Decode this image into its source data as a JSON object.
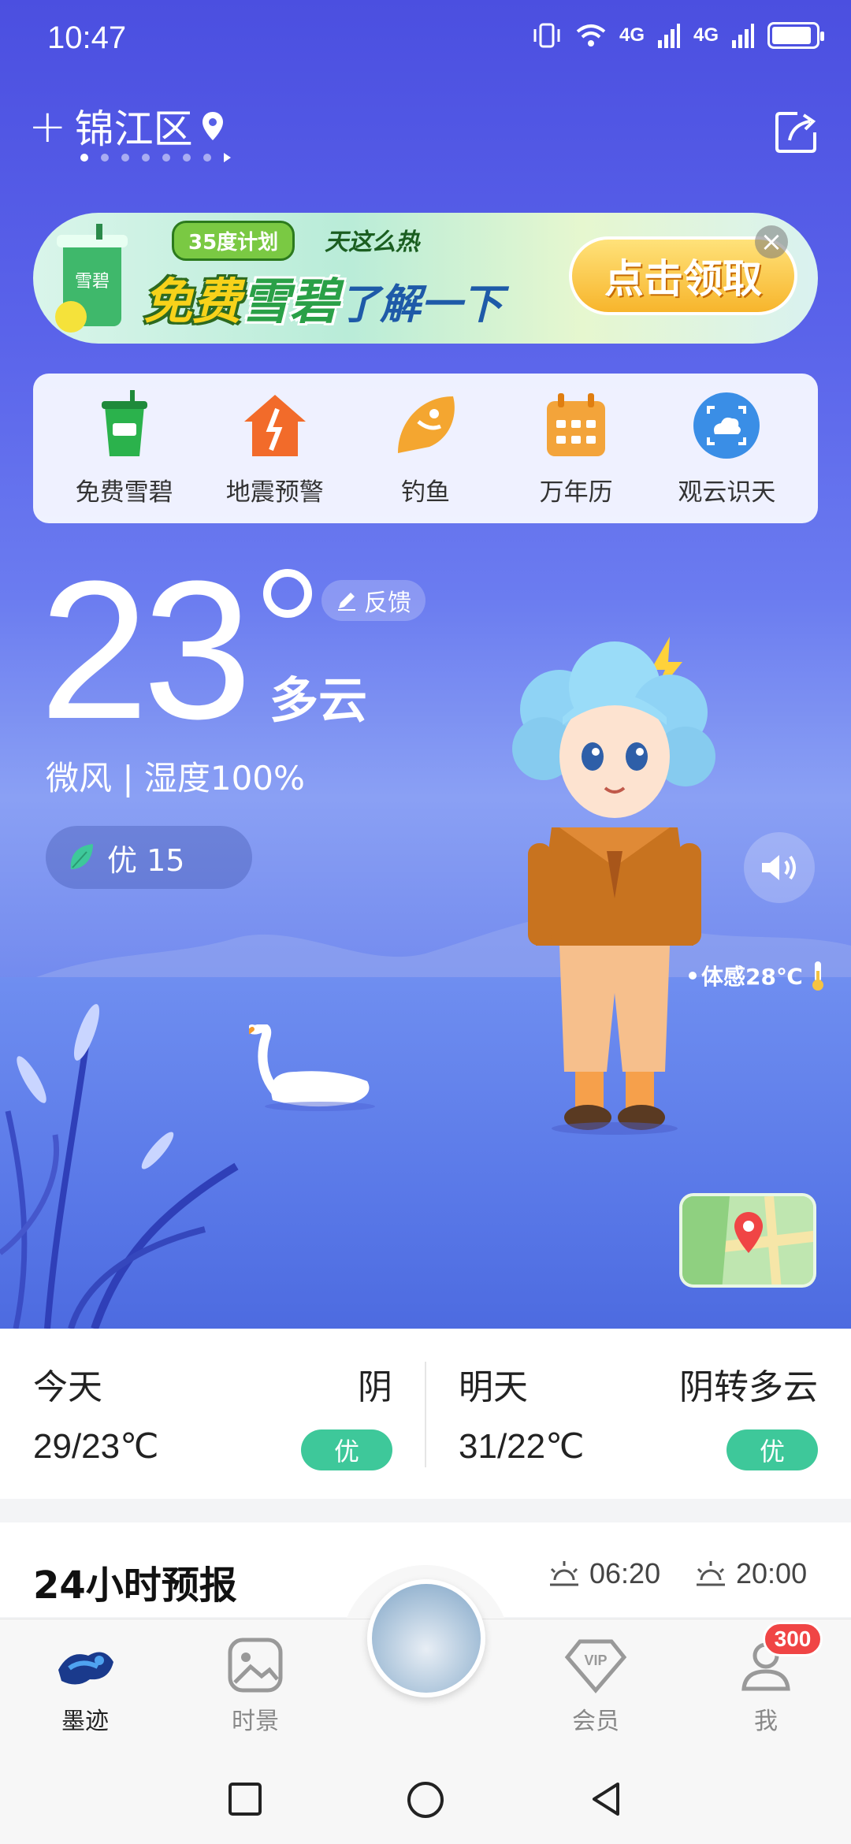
{
  "status": {
    "time": "10:47",
    "net1": "4G",
    "net2": "4G",
    "battery_level": 0.9
  },
  "location": {
    "add_symbol": "+",
    "city": "锦江区",
    "page_count": 7,
    "active_page": 1
  },
  "banner": {
    "tag": "35度计划",
    "subtitle": "天这么热",
    "main_1": "免费",
    "main_2": "雪碧",
    "main_3": "了解一下",
    "cup_text": "雪碧",
    "cta": "点击领取",
    "close": "×"
  },
  "quick_actions": [
    {
      "label": "免费雪碧",
      "icon": "sprite-cup-icon"
    },
    {
      "label": "地震预警",
      "icon": "earthquake-house-icon"
    },
    {
      "label": "钓鱼",
      "icon": "fish-icon"
    },
    {
      "label": "万年历",
      "icon": "calendar-icon"
    },
    {
      "label": "观云识天",
      "icon": "cloud-scan-icon"
    }
  ],
  "weather": {
    "temperature": "23",
    "condition": "多云",
    "wind_humidity": "微风 | 湿度100%",
    "aqi": "优 15",
    "feedback": "反馈",
    "feels_like": "体感28℃"
  },
  "days": [
    {
      "label": "今天",
      "condition": "阴",
      "temps": "29/23℃",
      "air": "优"
    },
    {
      "label": "明天",
      "condition": "阴转多云",
      "temps": "31/22℃",
      "air": "优"
    }
  ],
  "forecast": {
    "title": "24小时预报",
    "sunrise": "06:20",
    "sunset": "20:00"
  },
  "tabs": [
    {
      "label": "墨迹",
      "active": true
    },
    {
      "label": "时景",
      "active": false
    },
    {
      "label": "会员",
      "active": false
    },
    {
      "label": "我",
      "active": false
    }
  ],
  "vip_text": "VIP",
  "notification_count": "300",
  "colors": {
    "hero_top": "#4b4fe0",
    "air_good": "#3ec89a",
    "badge_red": "#f04545"
  }
}
